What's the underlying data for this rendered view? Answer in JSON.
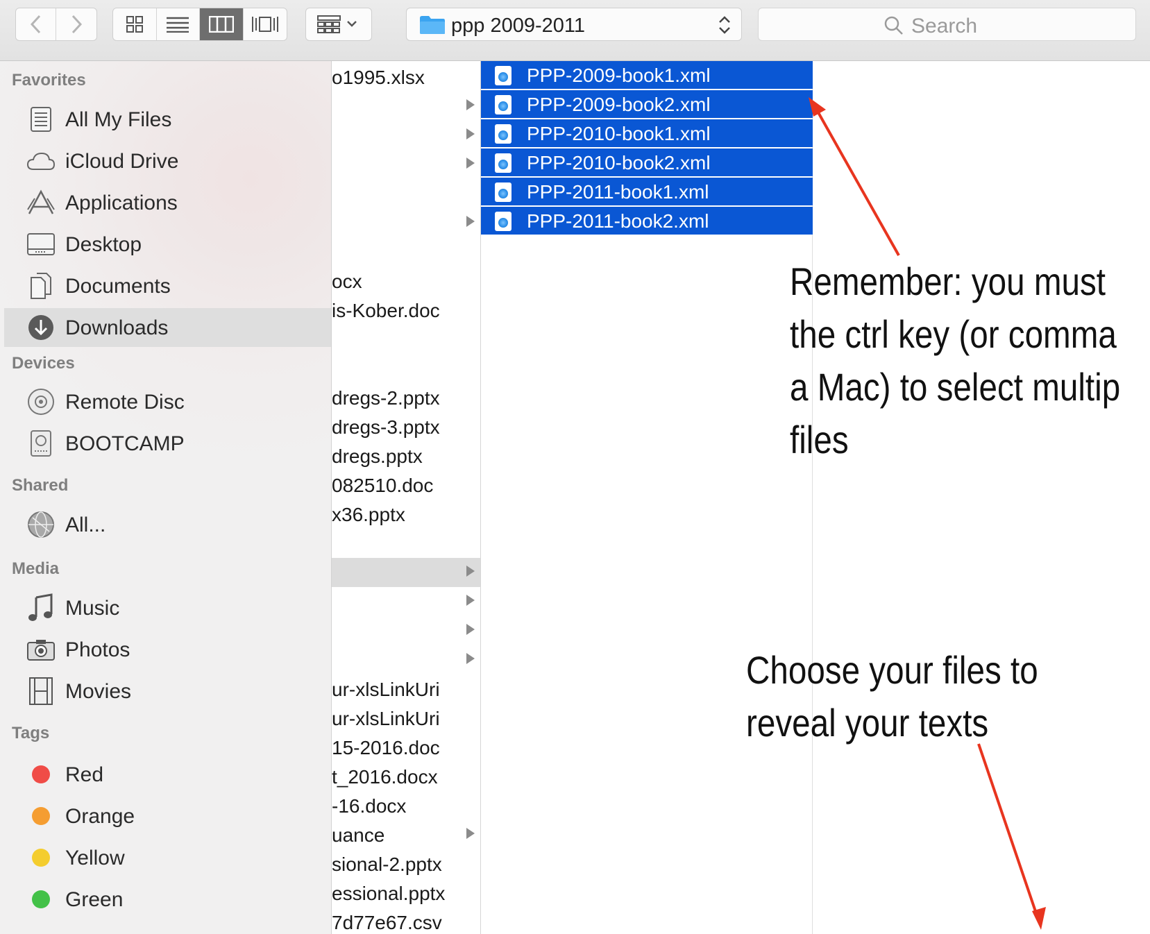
{
  "toolbar": {
    "back_label": "‹",
    "forward_label": "›",
    "path_folder": "ppp 2009-2011",
    "search_placeholder": "Search"
  },
  "sidebar": {
    "favorites_header": "Favorites",
    "favorites": [
      {
        "label": "All My Files",
        "icon": "all-files-icon"
      },
      {
        "label": "iCloud Drive",
        "icon": "cloud-icon"
      },
      {
        "label": "Applications",
        "icon": "applications-icon"
      },
      {
        "label": "Desktop",
        "icon": "desktop-icon"
      },
      {
        "label": "Documents",
        "icon": "documents-icon"
      },
      {
        "label": "Downloads",
        "icon": "downloads-icon",
        "selected": true
      }
    ],
    "devices_header": "Devices",
    "devices": [
      {
        "label": "Remote Disc",
        "icon": "disc-icon"
      },
      {
        "label": "BOOTCAMP",
        "icon": "drive-icon"
      }
    ],
    "shared_header": "Shared",
    "shared": [
      {
        "label": "All...",
        "icon": "network-icon"
      }
    ],
    "media_header": "Media",
    "media": [
      {
        "label": "Music",
        "icon": "music-icon"
      },
      {
        "label": "Photos",
        "icon": "camera-icon"
      },
      {
        "label": "Movies",
        "icon": "film-icon"
      }
    ],
    "tags_header": "Tags",
    "tags": [
      {
        "label": "Red",
        "color": "#f04c47"
      },
      {
        "label": "Orange",
        "color": "#f59d31"
      },
      {
        "label": "Yellow",
        "color": "#f4cd2e"
      },
      {
        "label": "Green",
        "color": "#43c148"
      }
    ]
  },
  "column1": {
    "rows": [
      {
        "text": "o1995.xlsx",
        "arrow": false
      },
      {
        "text": "",
        "arrow": true
      },
      {
        "text": "",
        "arrow": true
      },
      {
        "text": "",
        "arrow": true
      },
      {
        "text": "",
        "arrow": false
      },
      {
        "text": "",
        "arrow": true
      },
      {
        "text": "",
        "arrow": false
      },
      {
        "text": "ocx",
        "arrow": false
      },
      {
        "text": "is-Kober.doc",
        "arrow": false
      },
      {
        "text": "",
        "arrow": false
      },
      {
        "text": "",
        "arrow": false
      },
      {
        "text": "dregs-2.pptx",
        "arrow": false
      },
      {
        "text": "dregs-3.pptx",
        "arrow": false
      },
      {
        "text": "dregs.pptx",
        "arrow": false
      },
      {
        "text": "082510.doc",
        "arrow": false
      },
      {
        "text": "x36.pptx",
        "arrow": false
      },
      {
        "text": "",
        "arrow": false
      },
      {
        "text": "",
        "arrow": true,
        "highlighted": true
      },
      {
        "text": "",
        "arrow": true
      },
      {
        "text": "",
        "arrow": true
      },
      {
        "text": "",
        "arrow": true
      },
      {
        "text": "ur-xlsLinkUri",
        "arrow": false
      },
      {
        "text": "ur-xlsLinkUri",
        "arrow": false
      },
      {
        "text": "15-2016.doc",
        "arrow": false
      },
      {
        "text": "t_2016.docx",
        "arrow": false
      },
      {
        "text": "-16.docx",
        "arrow": false
      },
      {
        "text": "uance",
        "arrow": true
      },
      {
        "text": "sional-2.pptx",
        "arrow": false
      },
      {
        "text": "essional.pptx",
        "arrow": false
      },
      {
        "text": "7d77e67.csv",
        "arrow": false
      }
    ]
  },
  "column2": {
    "files": [
      "PPP-2009-book1.xml",
      "PPP-2009-book2.xml",
      "PPP-2010-book1.xml",
      "PPP-2010-book2.xml",
      "PPP-2011-book1.xml",
      "PPP-2011-book2.xml"
    ],
    "selection_color": "#0a57d4"
  },
  "annotations": {
    "note1_lines": [
      "Remember: you must",
      "the ctrl key (or comma",
      "a Mac) to select  multip",
      "files"
    ],
    "note2_lines": [
      "Choose your files to",
      "reveal your texts"
    ],
    "arrow_color": "#e8351f"
  }
}
